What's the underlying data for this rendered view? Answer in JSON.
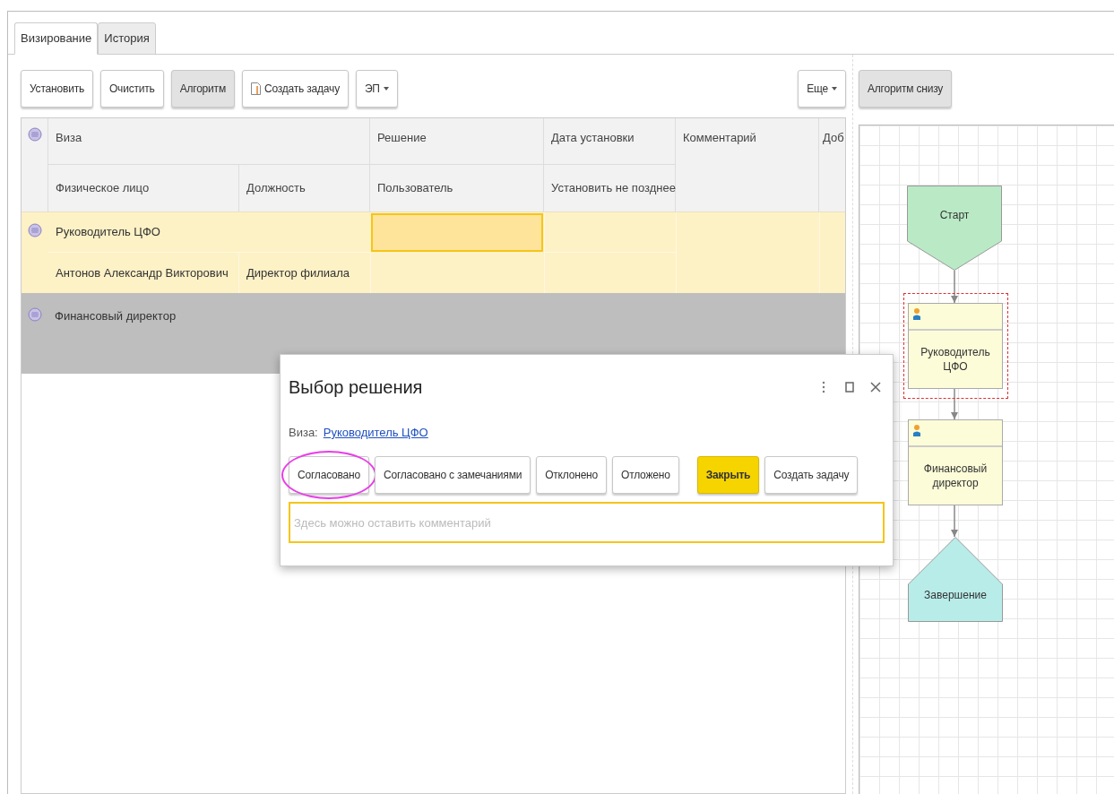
{
  "tabs": [
    {
      "label": "Визирование",
      "selected": true
    },
    {
      "label": "История",
      "selected": false
    }
  ],
  "toolbar": [
    {
      "label": "Установить",
      "kind": "button",
      "pressed": false
    },
    {
      "label": "Очистить",
      "kind": "button",
      "pressed": false
    },
    {
      "label": "Алгоритм",
      "kind": "button",
      "pressed": true
    },
    {
      "label": "Создать задачу",
      "kind": "document",
      "pressed": false
    },
    {
      "label": "ЭП",
      "kind": "dropdown",
      "pressed": false
    }
  ],
  "more_button": {
    "label": "Еще"
  },
  "algorithm_toggle": {
    "label": "Алгоритм снизу",
    "pressed": true
  },
  "table": {
    "header_top": [
      "Виза",
      "Решение",
      "Дата установки",
      "Комментарий",
      "Доб"
    ],
    "header_bottom": [
      "Физическое лицо",
      "Должность",
      "Пользователь",
      "Установить не позднее"
    ],
    "rows": [
      {
        "visa": "Руководитель ЦФО",
        "selected": true,
        "person": "Антонов Александр Викторович",
        "position": "Директор филиала"
      },
      {
        "visa": "Финансовый директор",
        "selected": false
      }
    ]
  },
  "dialog": {
    "title": "Выбор решения",
    "visa_label": "Виза:",
    "visa_link": "Руководитель ЦФО",
    "buttons": [
      {
        "label": "Согласовано",
        "kind": "default",
        "circled": true
      },
      {
        "label": "Согласовано с замечаниями",
        "kind": "default",
        "circled": false
      },
      {
        "label": "Отклонено",
        "kind": "default",
        "circled": false
      },
      {
        "label": "Отложено",
        "kind": "default",
        "circled": false
      },
      {
        "label": "Закрыть",
        "kind": "primary",
        "circled": false
      },
      {
        "label": "Создать задачу",
        "kind": "default",
        "circled": false
      }
    ],
    "comment": {
      "placeholder": "Здесь можно оставить комментарий"
    }
  },
  "diagram": {
    "nodes": [
      {
        "kind": "start",
        "label": "Старт",
        "selected": false
      },
      {
        "kind": "task",
        "label": "Руководитель ЦФО",
        "selected": true
      },
      {
        "kind": "task",
        "label": "Финансовый директор",
        "selected": false
      },
      {
        "kind": "end",
        "label": "Завершение",
        "selected": false
      }
    ]
  }
}
